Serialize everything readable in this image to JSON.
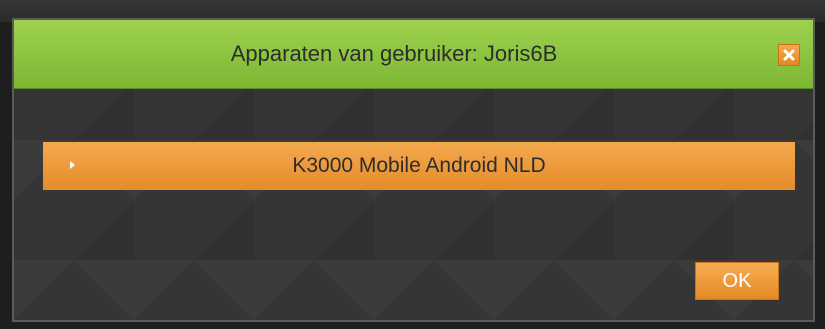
{
  "dialog": {
    "title": "Apparaten van gebruiker: Joris6B",
    "close_icon": "close-icon"
  },
  "devices": [
    {
      "label": "K3000 Mobile Android NLD",
      "icon": "expand-arrow-icon"
    }
  ],
  "buttons": {
    "ok_label": "OK"
  },
  "colors": {
    "titlebar": "#8cc63f",
    "accent_orange": "#eb962f",
    "dialog_bg": "#353535"
  }
}
